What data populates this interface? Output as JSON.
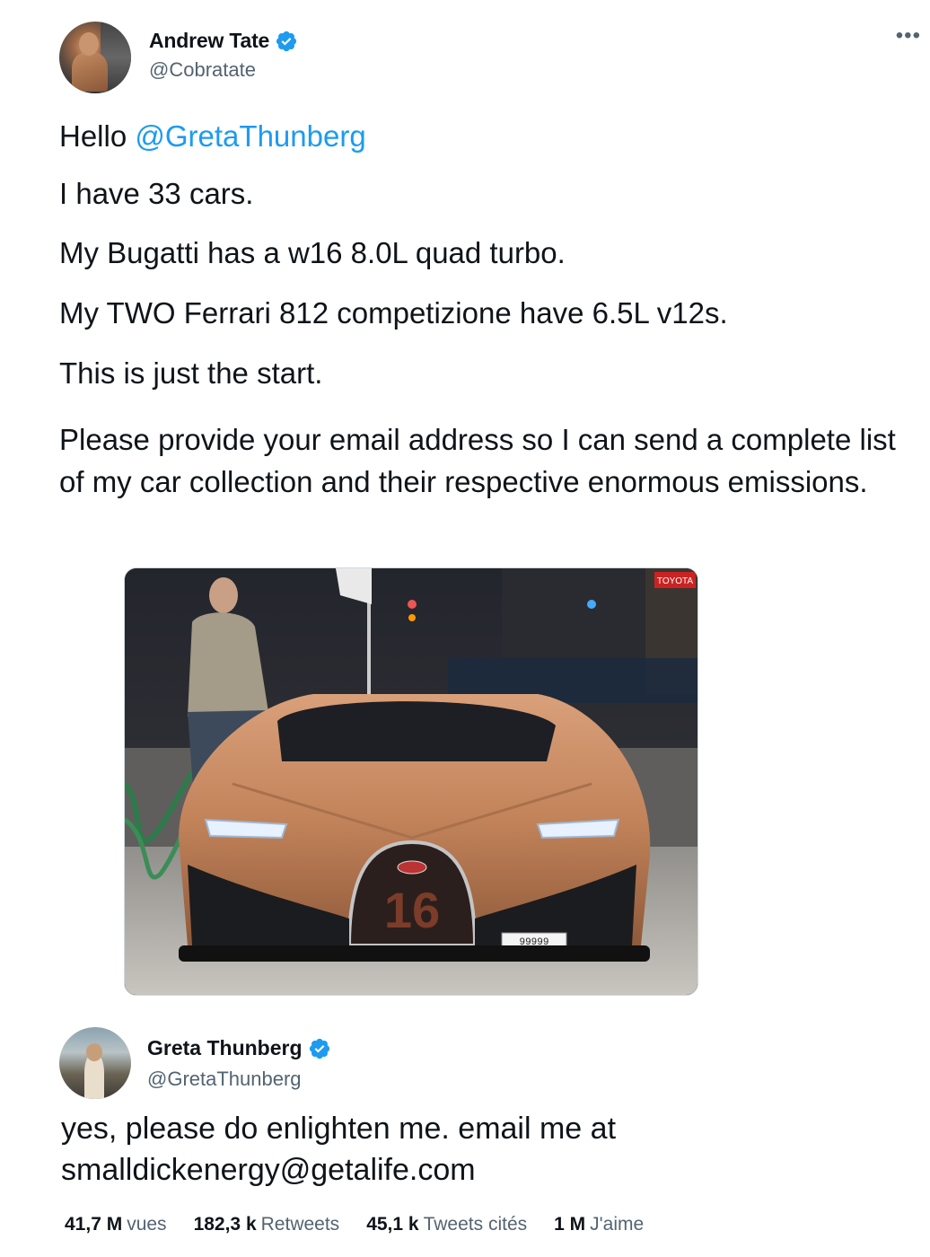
{
  "author": {
    "display_name": "Andrew Tate",
    "handle": "@Cobratate",
    "verified": true
  },
  "more_icon": "more-horizontal-icon",
  "tweet": {
    "greeting": "Hello ",
    "mention": "@GretaThunberg",
    "lines": [
      "I have 33 cars.",
      "My Bugatti has a w16 8.0L quad turbo.",
      "My TWO Ferrari 812 competizione have 6.5L v12s.",
      "This is just the start.",
      "Please provide your email address so I can send a complete list of my car collection and their respective enormous emissions."
    ]
  },
  "media": {
    "sign_text": "TOYOTA",
    "grille_number": "16",
    "plate": "99999"
  },
  "quote": {
    "display_name": "Greta Thunberg",
    "handle": "@GretaThunberg",
    "verified": true,
    "text": "yes, please do enlighten me. email me at smalldickenergy@getalife.com"
  },
  "stats": {
    "views_value": "41,7 M",
    "views_label": "vues",
    "retweets_value": "182,3 k",
    "retweets_label": "Retweets",
    "quotes_value": "45,1 k",
    "quotes_label": "Tweets cités",
    "likes_value": "1 M",
    "likes_label": "J'aime"
  },
  "colors": {
    "link": "#1d9bf0",
    "verified": "#1d9bf0",
    "secondary_text": "#536471",
    "car_body": "#c98b5e"
  }
}
